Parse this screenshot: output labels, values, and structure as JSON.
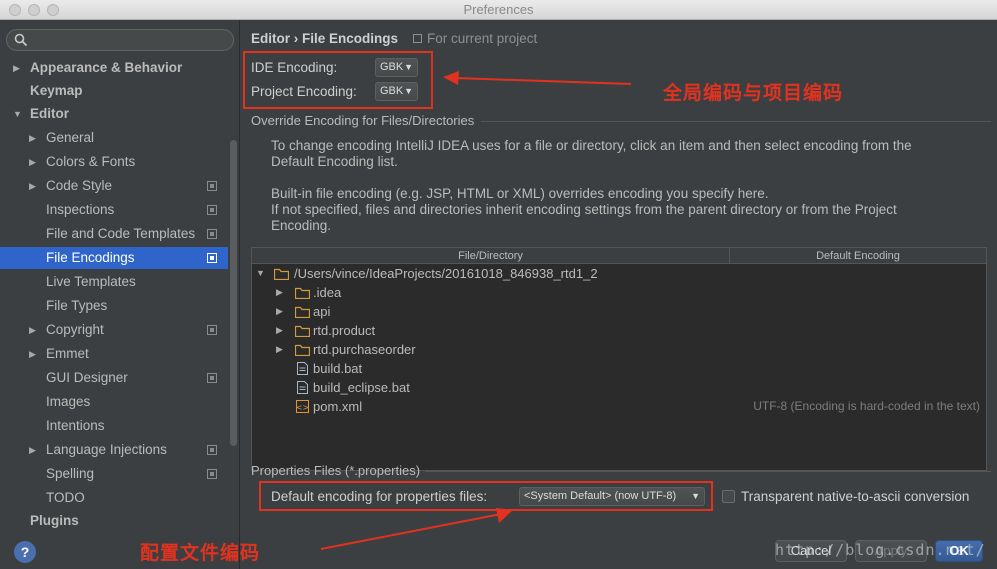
{
  "window": {
    "title": "Preferences"
  },
  "sidebar": {
    "search_placeholder": "",
    "items": [
      {
        "label": "Appearance & Behavior",
        "arrow": "▶"
      },
      {
        "label": "Keymap"
      },
      {
        "label": "Editor",
        "arrow": "▼"
      },
      {
        "label": "General",
        "arrow": "▶"
      },
      {
        "label": "Colors & Fonts",
        "arrow": "▶"
      },
      {
        "label": "Code Style",
        "arrow": "▶"
      },
      {
        "label": "Inspections"
      },
      {
        "label": "File and Code Templates"
      },
      {
        "label": "File Encodings"
      },
      {
        "label": "Live Templates"
      },
      {
        "label": "File Types"
      },
      {
        "label": "Copyright",
        "arrow": "▶"
      },
      {
        "label": "Emmet",
        "arrow": "▶"
      },
      {
        "label": "GUI Designer"
      },
      {
        "label": "Images"
      },
      {
        "label": "Intentions"
      },
      {
        "label": "Language Injections",
        "arrow": "▶"
      },
      {
        "label": "Spelling"
      },
      {
        "label": "TODO"
      },
      {
        "label": "Plugins"
      }
    ],
    "help": "?"
  },
  "main": {
    "breadcrumb": "Editor › File Encodings",
    "scope_note": "For current project",
    "ide_encoding_label": "IDE Encoding:",
    "ide_encoding_value": "GBK",
    "project_encoding_label": "Project Encoding:",
    "project_encoding_value": "GBK",
    "annotation_top": "全局编码与项目编码",
    "override_title": "Override Encoding for Files/Directories",
    "info_1a": "To change encoding IntelliJ IDEA uses for a file or directory, click an item and then select encoding from the",
    "info_1b": "Default Encoding list.",
    "info_2a": "Built-in file encoding (e.g. JSP, HTML or XML) overrides encoding you specify here.",
    "info_2b": "If not specified, files and directories inherit encoding settings from the parent directory or from the Project",
    "info_2c": "Encoding.",
    "table": {
      "col_file": "File/Directory",
      "col_encoding": "Default Encoding",
      "root": "/Users/vince/IdeaProjects/20161018_846938_rtd1_2",
      "rows": [
        {
          "name": ".idea",
          "type": "folder",
          "arrow": "▶"
        },
        {
          "name": "api",
          "type": "folder",
          "arrow": "▶"
        },
        {
          "name": "rtd.product",
          "type": "folder",
          "arrow": "▶"
        },
        {
          "name": "rtd.purchaseorder",
          "type": "folder",
          "arrow": "▶"
        },
        {
          "name": "build.bat",
          "type": "file"
        },
        {
          "name": "build_eclipse.bat",
          "type": "file"
        },
        {
          "name": "pom.xml",
          "type": "xml",
          "encoding": "UTF-8 (Encoding is hard-coded in the text)"
        }
      ]
    },
    "properties_title": "Properties Files (*.properties)",
    "properties_label": "Default encoding for properties files:",
    "properties_value": "<System Default> (now UTF-8)",
    "transparent_label": "Transparent native-to-ascii conversion",
    "annotation_bottom": "配置文件编码",
    "buttons": {
      "cancel": "Cancel",
      "apply": "Apply",
      "ok": "OK"
    },
    "watermark": "http://blog.csdn.net/"
  },
  "colors": {
    "accent": "#2f65ca",
    "annotation": "#e2321f",
    "background": "#3c3f41"
  }
}
